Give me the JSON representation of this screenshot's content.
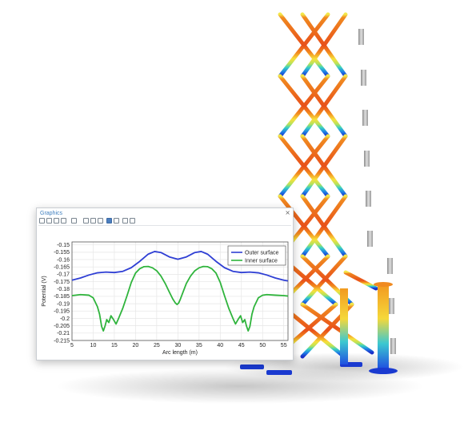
{
  "panel": {
    "title": "Graphics",
    "close_glyph": "×",
    "toolbar_icons": [
      "zoom-in-icon",
      "zoom-out-icon",
      "zoom-box-icon",
      "zoom-extents-icon",
      "view-dropdown-icon",
      "grid-icon",
      "axis-icon",
      "table-icon",
      "plot-image-icon",
      "export-image-icon",
      "print-icon"
    ]
  },
  "chart_data": {
    "type": "line",
    "xlabel": "Arc length (m)",
    "ylabel": "Potential (V)",
    "xlim": [
      5,
      56
    ],
    "ylim": [
      -0.215,
      -0.148
    ],
    "xticks": [
      "5",
      "10",
      "15",
      "20",
      "25",
      "30",
      "35",
      "40",
      "45",
      "50",
      "55"
    ],
    "yticks": [
      "-0.15",
      "-0.155",
      "-0.16",
      "-0.165",
      "-0.17",
      "-0.175",
      "-0.18",
      "-0.185",
      "-0.19",
      "-0.195",
      "-0.2",
      "-0.205",
      "-0.21",
      "-0.215"
    ],
    "grid": true,
    "legend_position": "top-right",
    "series": [
      {
        "name": "Outer surface",
        "color": "#2f3fd4",
        "x": [
          5,
          7,
          9,
          11,
          13,
          15,
          17,
          19,
          21,
          23,
          24.5,
          26,
          28,
          30,
          32,
          34,
          35.5,
          37,
          39,
          41,
          43,
          45,
          47,
          49,
          51,
          53,
          55,
          56
        ],
        "y": [
          -0.174,
          -0.1725,
          -0.1705,
          -0.169,
          -0.1685,
          -0.1688,
          -0.168,
          -0.1655,
          -0.1612,
          -0.1563,
          -0.1545,
          -0.1552,
          -0.1582,
          -0.1598,
          -0.1582,
          -0.1552,
          -0.1545,
          -0.1563,
          -0.1612,
          -0.1655,
          -0.168,
          -0.1688,
          -0.1685,
          -0.169,
          -0.1705,
          -0.1725,
          -0.174,
          -0.1745
        ]
      },
      {
        "name": "Inner surface",
        "color": "#2fb43c",
        "x": [
          5,
          7,
          9,
          10,
          11,
          11.5,
          12,
          12.4,
          12.8,
          13.2,
          13.7,
          14.2,
          14.8,
          15.4,
          16,
          17,
          18,
          19,
          20,
          21,
          22,
          23,
          24,
          25,
          26,
          27,
          28,
          28.8,
          29.4,
          29.8,
          30.2,
          30.6,
          31.2,
          32,
          33,
          34,
          35,
          36,
          37,
          38,
          39,
          40,
          41,
          42,
          43,
          43.6,
          44.2,
          44.8,
          45.3,
          45.8,
          46.2,
          46.6,
          47,
          47.5,
          48,
          49,
          50,
          51,
          53,
          55,
          56
        ],
        "y": [
          -0.1845,
          -0.1838,
          -0.1842,
          -0.186,
          -0.192,
          -0.197,
          -0.2055,
          -0.2085,
          -0.2052,
          -0.2008,
          -0.2028,
          -0.1982,
          -0.2008,
          -0.2038,
          -0.2,
          -0.193,
          -0.1845,
          -0.1755,
          -0.1692,
          -0.1662,
          -0.1648,
          -0.1647,
          -0.1656,
          -0.1676,
          -0.1712,
          -0.1762,
          -0.1822,
          -0.1868,
          -0.1895,
          -0.1905,
          -0.1895,
          -0.1868,
          -0.1822,
          -0.1762,
          -0.1712,
          -0.1676,
          -0.1656,
          -0.1647,
          -0.1648,
          -0.1662,
          -0.1692,
          -0.1755,
          -0.1845,
          -0.193,
          -0.2,
          -0.2038,
          -0.2008,
          -0.1982,
          -0.2028,
          -0.2008,
          -0.2052,
          -0.2085,
          -0.2055,
          -0.197,
          -0.192,
          -0.186,
          -0.1842,
          -0.1838,
          -0.1842,
          -0.1845,
          -0.1848
        ]
      }
    ]
  }
}
